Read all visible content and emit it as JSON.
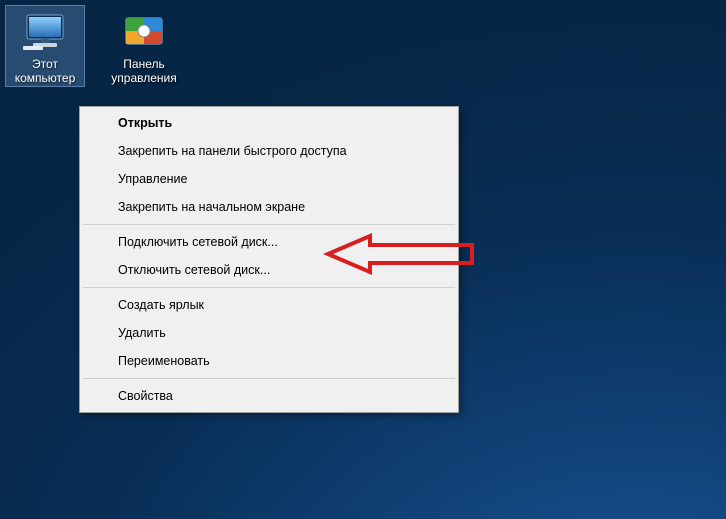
{
  "desktop": {
    "icons": [
      {
        "id": "this-pc",
        "label": "Этот компьютер",
        "selected": true
      },
      {
        "id": "control-panel",
        "label": "Панель управления",
        "selected": false
      }
    ]
  },
  "context_menu": {
    "items": [
      {
        "type": "item",
        "label": "Открыть",
        "bold": true
      },
      {
        "type": "item",
        "label": "Закрепить на панели быстрого доступа",
        "bold": false
      },
      {
        "type": "item",
        "label": "Управление",
        "bold": false
      },
      {
        "type": "item",
        "label": "Закрепить на начальном экране",
        "bold": false
      },
      {
        "type": "sep"
      },
      {
        "type": "item",
        "label": "Подключить сетевой диск...",
        "bold": false,
        "highlighted": true
      },
      {
        "type": "item",
        "label": "Отключить сетевой диск...",
        "bold": false
      },
      {
        "type": "sep"
      },
      {
        "type": "item",
        "label": "Создать ярлык",
        "bold": false
      },
      {
        "type": "item",
        "label": "Удалить",
        "bold": false
      },
      {
        "type": "item",
        "label": "Переименовать",
        "bold": false
      },
      {
        "type": "sep"
      },
      {
        "type": "item",
        "label": "Свойства",
        "bold": false
      }
    ]
  },
  "annotation": {
    "arrow_color": "#d81e1e"
  }
}
